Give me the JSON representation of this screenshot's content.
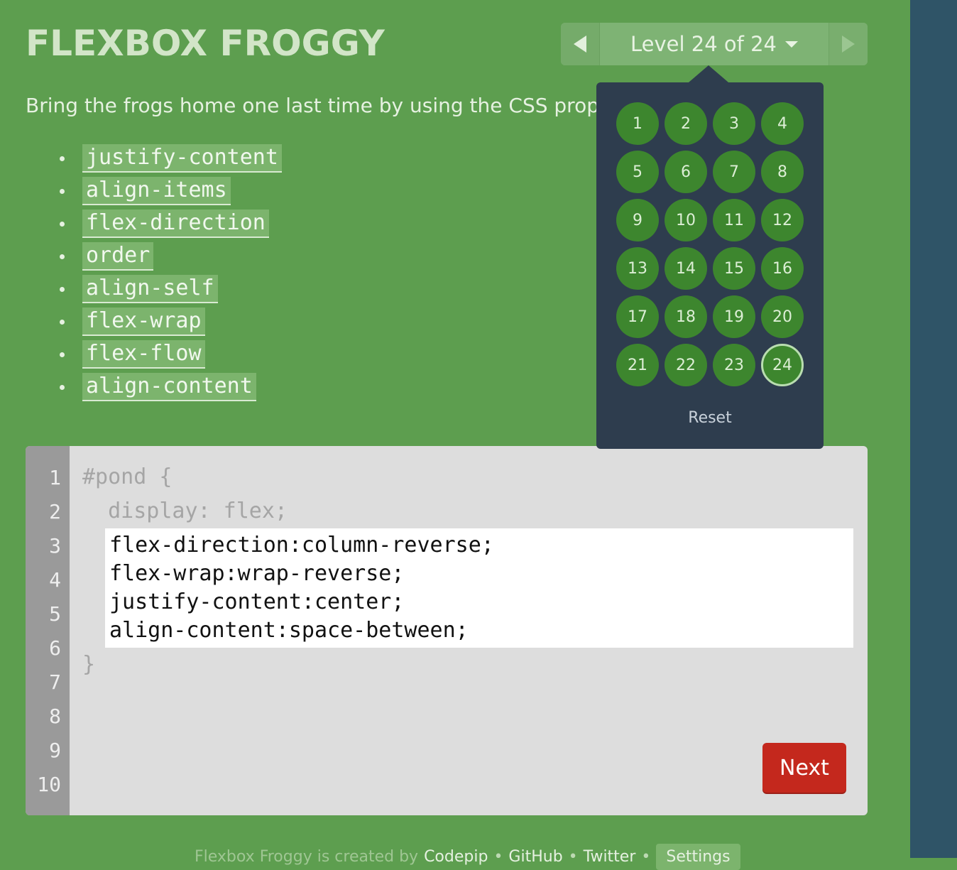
{
  "header": {
    "title": "FLEXBOX FROGGY",
    "level_label": "Level 24 of 24",
    "prev_icon": "triangle-left-icon",
    "next_icon": "triangle-right-icon",
    "caret_icon": "caret-down-icon"
  },
  "instructions": "Bring the frogs home one last time by using the CSS properties",
  "properties": [
    "justify-content",
    "align-items",
    "flex-direction",
    "order",
    "align-self",
    "flex-wrap",
    "flex-flow",
    "align-content"
  ],
  "level_menu": {
    "levels": [
      "1",
      "2",
      "3",
      "4",
      "5",
      "6",
      "7",
      "8",
      "9",
      "10",
      "11",
      "12",
      "13",
      "14",
      "15",
      "16",
      "17",
      "18",
      "19",
      "20",
      "21",
      "22",
      "23",
      "24"
    ],
    "current": "24",
    "reset_label": "Reset"
  },
  "editor": {
    "line_numbers": [
      "1",
      "2",
      "3",
      "4",
      "5",
      "6",
      "7",
      "8",
      "9",
      "10"
    ],
    "open_line": "#pond {",
    "display_line": "  display: flex;",
    "input_lines": [
      "flex-direction:column-reverse;",
      "flex-wrap:wrap-reverse;",
      "justify-content:center;",
      "align-content:space-between;"
    ],
    "close_line": "}",
    "next_label": "Next"
  },
  "footer": {
    "prefix": "Flexbox Froggy is created by",
    "links": [
      "Codepip",
      "GitHub",
      "Twitter"
    ],
    "settings_label": "Settings"
  },
  "colors": {
    "background": "#5d9e4f",
    "popup": "#2e3d4e",
    "level_dot": "#3d862e",
    "next_button": "#c4281d",
    "pond": "#2f5467",
    "lilypad": "#cfd54a"
  }
}
